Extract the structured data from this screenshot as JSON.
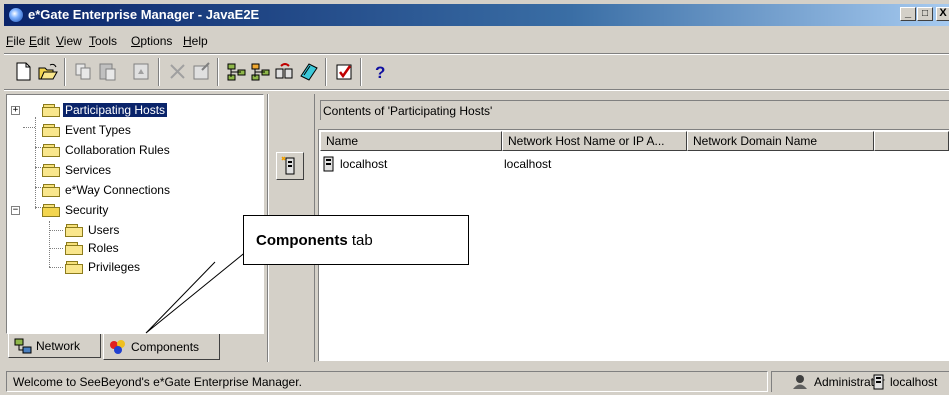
{
  "window": {
    "title": "e*Gate Enterprise Manager - JavaE2E",
    "minimize": "_",
    "maximize": "□",
    "close": "X"
  },
  "menu": {
    "items": [
      {
        "first": "F",
        "rest": "ile"
      },
      {
        "first": "E",
        "rest": "dit"
      },
      {
        "first": "V",
        "rest": "iew"
      },
      {
        "first": "T",
        "rest": "ools"
      },
      {
        "first": "O",
        "rest": "ptions"
      },
      {
        "first": "H",
        "rest": "elp"
      }
    ]
  },
  "toolbar": {
    "help_label": "?",
    "icons": [
      "new-icon",
      "open-icon",
      "copy-icon",
      "paste-icon",
      "promote-icon",
      "delete-icon",
      "properties-icon",
      "network-add-icon",
      "network-edit-icon",
      "schema-icon",
      "editor-icon",
      "validate-icon",
      "help-icon"
    ]
  },
  "tree": {
    "items": [
      {
        "label": "Participating Hosts",
        "selected": true
      },
      {
        "label": "Event Types"
      },
      {
        "label": "Collaboration Rules"
      },
      {
        "label": "Services"
      },
      {
        "label": "e*Way Connections"
      },
      {
        "label": "Security"
      },
      {
        "label": "Users"
      },
      {
        "label": "Roles"
      },
      {
        "label": "Privileges"
      }
    ],
    "expand_plus": "+",
    "expand_minus": "−"
  },
  "tabs": {
    "network": "Network",
    "components": "Components"
  },
  "content": {
    "caption": "Contents of  'Participating Hosts'",
    "columns": [
      "Name",
      "Network Host Name or IP A...",
      "Network Domain Name",
      ""
    ],
    "rows": [
      {
        "name": "localhost",
        "host": "localhost",
        "domain": ""
      }
    ]
  },
  "callout": {
    "bold": "Components",
    "rest": " tab"
  },
  "status": {
    "message": "Welcome to SeeBeyond's e*Gate Enterprise Manager.",
    "user": "Administrator",
    "host": "localhost"
  },
  "colors": {
    "title_bar": "#0a246a",
    "selection": "#0a246a",
    "chrome": "#d4d0c8"
  }
}
